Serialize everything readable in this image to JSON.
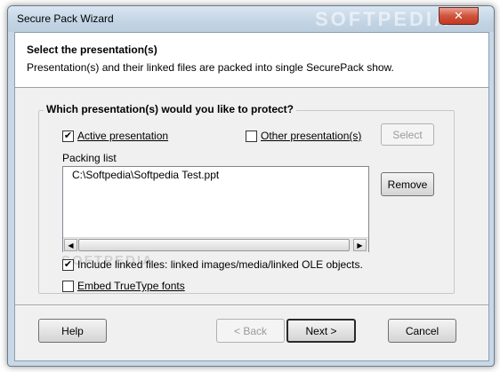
{
  "window": {
    "title": "Secure Pack Wizard",
    "watermark": "SOFTPEDIA",
    "close_glyph": "✕"
  },
  "header": {
    "title": "Select the presentation(s)",
    "subtitle": "Presentation(s) and their linked files are packed into single SecurePack show."
  },
  "group": {
    "title": "Which presentation(s) would you like to protect?",
    "active_presentation": {
      "label": "Active presentation",
      "checked": true
    },
    "other_presentation": {
      "label": "Other presentation(s)",
      "checked": false
    },
    "select_button": "Select",
    "packing_list_label": "Packing list",
    "packing_items": [
      "C:\\Softpedia\\Softpedia Test.ppt"
    ],
    "remove_button": "Remove",
    "include_linked": {
      "label": "Include linked files: linked images/media/linked OLE objects.",
      "checked": true
    },
    "embed_truetype": {
      "label": "Embed TrueType fonts",
      "checked": false
    },
    "watermark": "SOFTPEDIA"
  },
  "footer": {
    "help": "Help",
    "back": "< Back",
    "next": "Next >",
    "cancel": "Cancel"
  },
  "icons": {
    "check": "✔",
    "arrow_left": "◀",
    "arrow_right": "▶"
  }
}
